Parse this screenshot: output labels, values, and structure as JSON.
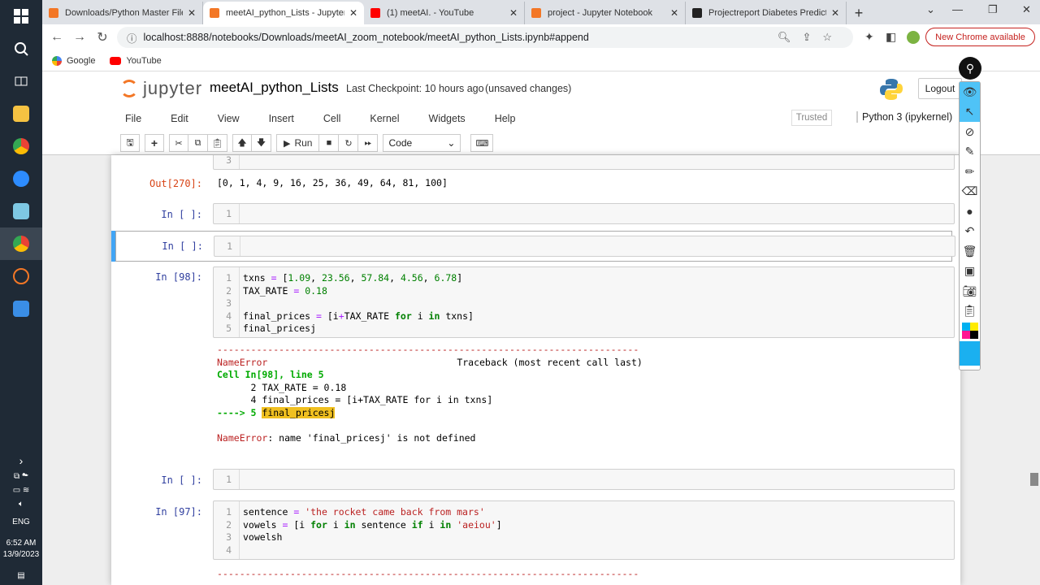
{
  "taskbar": {
    "start_icon": "windows-icon",
    "apps": [
      "file-explorer",
      "chrome",
      "zoom",
      "notes",
      "chrome-profile",
      "jupyter-app",
      "photos"
    ],
    "time": "6:52 AM",
    "date": "13/9/2023",
    "lang": "ENG"
  },
  "browser": {
    "tabs": [
      {
        "title": "Downloads/Python Master Files/",
        "icon_color": "#f37726",
        "active": false
      },
      {
        "title": "meetAI_python_Lists - Jupyter No",
        "icon_color": "#f37726",
        "active": true
      },
      {
        "title": "(1) meetAI. - YouTube",
        "icon_color": "#ff0000",
        "active": false
      },
      {
        "title": "project - Jupyter Notebook",
        "icon_color": "#f37726",
        "active": false
      },
      {
        "title": "Projectreport Diabetes Predictio",
        "icon_color": "#222222",
        "active": false
      }
    ],
    "new_tab": "+",
    "url": "localhost:8888/notebooks/Downloads/meetAI_zoom_notebook/meetAI_python_Lists.ipynb#append",
    "new_chrome": "New Chrome available",
    "bookmarks": [
      {
        "label": "Google",
        "color": "#4285f4"
      },
      {
        "label": "YouTube",
        "color": "#ff0000"
      }
    ]
  },
  "jupyter": {
    "logo_text": "jupyter",
    "notebook_name": "meetAI_python_Lists",
    "checkpoint": "Last Checkpoint: 10 hours ago",
    "unsaved": "(unsaved changes)",
    "logout": "Logout",
    "menus": [
      "File",
      "Edit",
      "View",
      "Insert",
      "Cell",
      "Kernel",
      "Widgets",
      "Help"
    ],
    "trusted": "Trusted",
    "kernel": "Python 3 (ipykernel)",
    "run_label": "Run",
    "cell_type": "Code"
  },
  "cells": {
    "top_stub_line": "3",
    "out270": {
      "prompt": "Out[270]:",
      "text": "[0, 1, 4, 9, 16, 25, 36, 49, 64, 81, 100]"
    },
    "empty1": {
      "prompt": "In [ ]:",
      "line": "1"
    },
    "empty2": {
      "prompt": "In [ ]:",
      "line": "1"
    },
    "in98": {
      "prompt": "In [98]:",
      "line_numbers": [
        "1",
        "2",
        "3",
        "4",
        "5"
      ],
      "tb_dashes": "---------------------------------------------------------------------------",
      "tb_name": "NameError",
      "tb_header": "Traceback (most recent call last)",
      "tb_cell": "Cell In[98], line 5",
      "tb_l2": "      2 TAX_RATE = 0.18",
      "tb_l4": "      4 final_prices = [i+TAX_RATE for i in txns]",
      "tb_arrow": "----> 5 ",
      "tb_bad": "final_pricesj",
      "err_msg": ": name 'final_pricesj' is not defined"
    },
    "empty3": {
      "prompt": "In [ ]:",
      "line": "1"
    },
    "in97": {
      "prompt": "In [97]:",
      "line_numbers": [
        "1",
        "2",
        "3",
        "4"
      ]
    },
    "tail_dashes": "---------------------------------------------------------------------------"
  }
}
